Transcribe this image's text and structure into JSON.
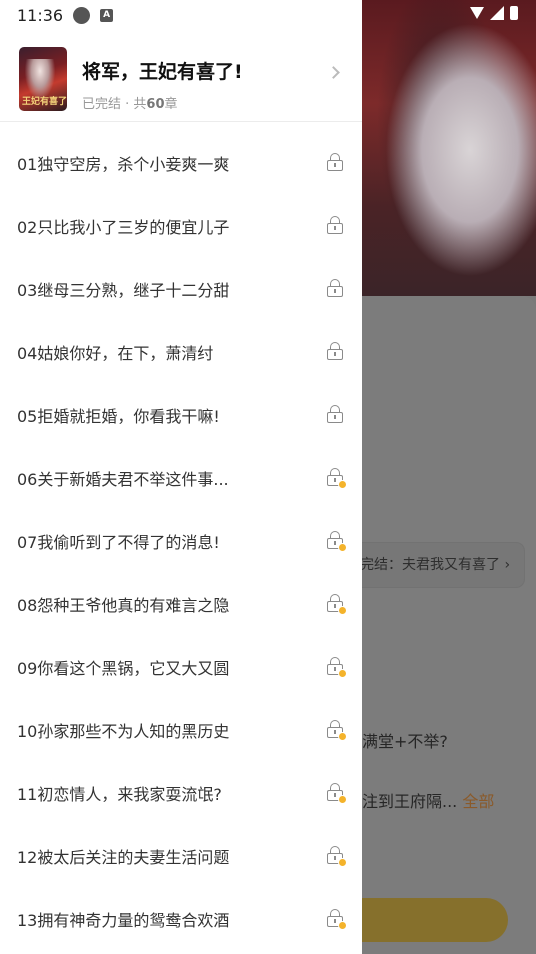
{
  "status_bar": {
    "time": "11:36",
    "notif_letter": "A"
  },
  "book": {
    "title": "将军，王妃有喜了!",
    "status": "已完结",
    "separator": " · 共",
    "chapter_count": "60",
    "chapter_unit": "章",
    "cover_text": "王妃有喜了"
  },
  "chapters": [
    {
      "label": "01独守空房，杀个小妾爽一爽",
      "coin": false
    },
    {
      "label": "02只比我小了三岁的便宜儿子",
      "coin": false
    },
    {
      "label": "03继母三分熟，继子十二分甜",
      "coin": false
    },
    {
      "label": "04姑娘你好，在下，萧清纣",
      "coin": false
    },
    {
      "label": "05拒婚就拒婚，你看我干嘛!",
      "coin": false
    },
    {
      "label": "06关于新婚夫君不举这件事...",
      "coin": true
    },
    {
      "label": "07我偷听到了不得了的消息!",
      "coin": true
    },
    {
      "label": "08怨种王爷他真的有难言之隐",
      "coin": true
    },
    {
      "label": "09你看这个黑锅，它又大又圆",
      "coin": true
    },
    {
      "label": "10孙家那些不为人知的黑历史",
      "coin": true
    },
    {
      "label": "11初恋情人，来我家耍流氓?",
      "coin": true
    },
    {
      "label": "12被太后关注的夫妻生活问题",
      "coin": true
    },
    {
      "label": "13拥有神奇力量的鸳鸯合欢酒",
      "coin": true
    }
  ],
  "background": {
    "chip_text": "完结：夫君我又有喜了 ›",
    "text1": "满堂+不举?",
    "text2": "注到王府隔...",
    "more": "全部"
  }
}
